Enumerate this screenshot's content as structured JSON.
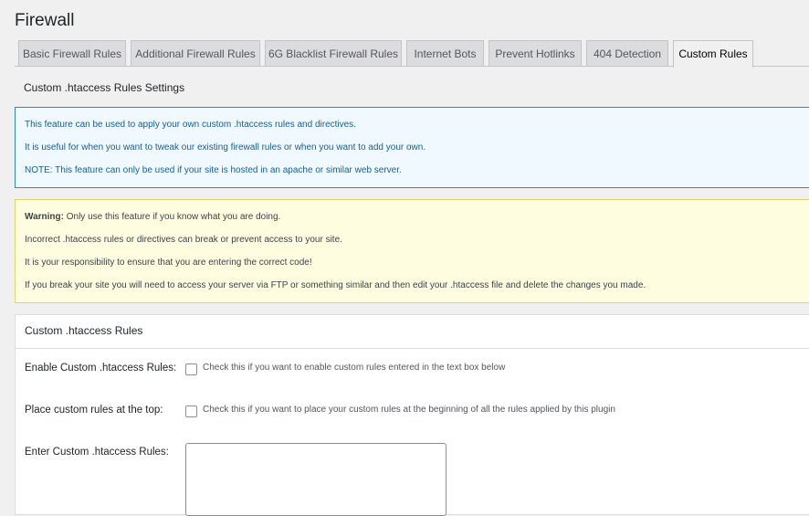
{
  "page": {
    "title": "Firewall"
  },
  "tabs": [
    {
      "label": "Basic Firewall Rules",
      "active": false
    },
    {
      "label": "Additional Firewall Rules",
      "active": false
    },
    {
      "label": "6G Blacklist Firewall Rules",
      "active": false
    },
    {
      "label": "Internet Bots",
      "active": false
    },
    {
      "label": "Prevent Hotlinks",
      "active": false
    },
    {
      "label": "404 Detection",
      "active": false
    },
    {
      "label": "Custom Rules",
      "active": true
    }
  ],
  "section": {
    "subtitle": "Custom .htaccess Rules Settings"
  },
  "info_box": {
    "line1": "This feature can be used to apply your own custom .htaccess rules and directives.",
    "line2": "It is useful for when you want to tweak our existing firewall rules or when you want to add your own.",
    "line3": "NOTE: This feature can only be used if your site is hosted in an apache or similar web server."
  },
  "warning_box": {
    "label": "Warning:",
    "line1_rest": " Only use this feature if you know what you are doing.",
    "line2": "Incorrect .htaccess rules or directives can break or prevent access to your site.",
    "line3": "It is your responsibility to ensure that you are entering the correct code!",
    "line4": "If you break your site you will need to access your server via FTP or something similar and then edit your .htaccess file and delete the changes you made."
  },
  "panel": {
    "title": "Custom .htaccess Rules",
    "enable": {
      "label": "Enable Custom .htaccess Rules:",
      "description": "Check this if you want to enable custom rules entered in the text box below",
      "checked": false
    },
    "place_top": {
      "label": "Place custom rules at the top:",
      "description": "Check this if you want to place your custom rules at the beginning of all the rules applied by this plugin",
      "checked": false
    },
    "rules_input": {
      "label": "Enter Custom .htaccess Rules:",
      "value": ""
    }
  }
}
